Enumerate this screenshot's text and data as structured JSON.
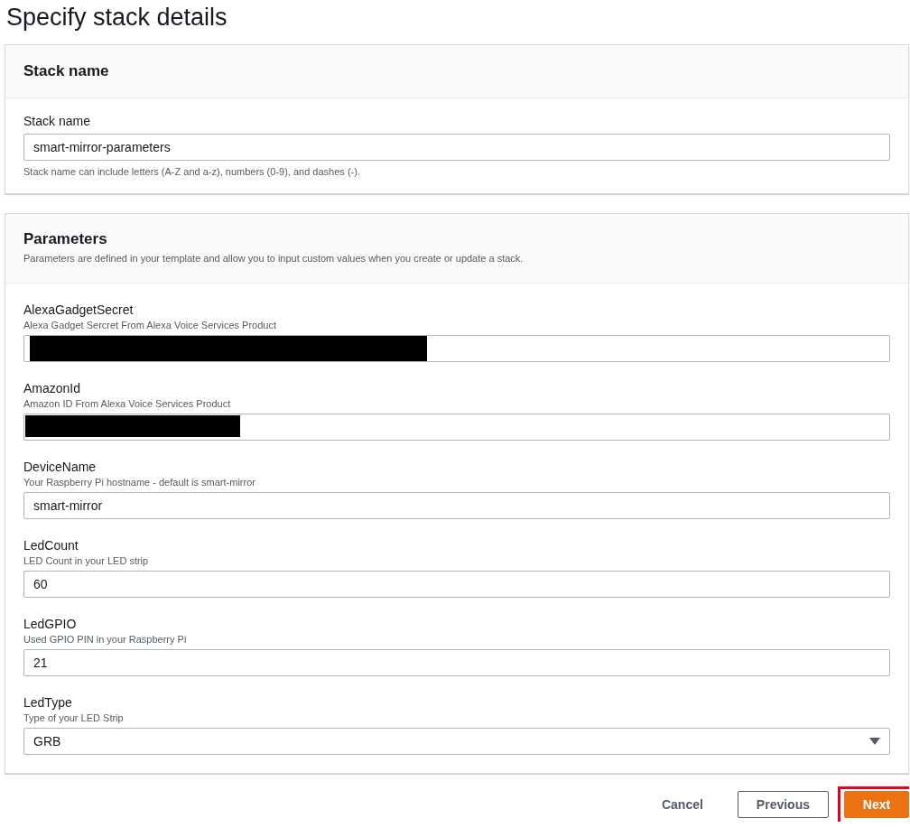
{
  "page_title": "Specify stack details",
  "stack_name_panel": {
    "title": "Stack name",
    "field": {
      "label": "Stack name",
      "value": "smart-mirror-parameters",
      "hint": "Stack name can include letters (A-Z and a-z), numbers (0-9), and dashes (-)."
    }
  },
  "parameters_panel": {
    "title": "Parameters",
    "description": "Parameters are defined in your template and allow you to input custom values when you create or update a stack.",
    "fields": [
      {
        "kind": "text",
        "label": "AlexaGadgetSecret",
        "description": "Alexa Gadget Sercret From Alexa Voice Services Product",
        "redacted": true
      },
      {
        "kind": "text",
        "label": "AmazonId",
        "description": "Amazon ID From Alexa Voice Services Product",
        "redacted": true
      },
      {
        "kind": "text",
        "label": "DeviceName",
        "description": "Your Raspberry Pi hostname - default is smart-mirror",
        "value": "smart-mirror"
      },
      {
        "kind": "text",
        "label": "LedCount",
        "description": "LED Count in your LED strip",
        "value": "60"
      },
      {
        "kind": "text",
        "label": "LedGPIO",
        "description": "Used GPIO PIN in your Raspberry Pi",
        "value": "21"
      },
      {
        "kind": "select",
        "label": "LedType",
        "description": "Type of your LED Strip",
        "value": "GRB"
      }
    ]
  },
  "buttons": [
    {
      "kind": "link",
      "label": "Cancel",
      "highlighted": false
    },
    {
      "kind": "secondary",
      "label": "Previous",
      "highlighted": false
    },
    {
      "kind": "primary",
      "label": "Next",
      "highlighted": true
    }
  ]
}
